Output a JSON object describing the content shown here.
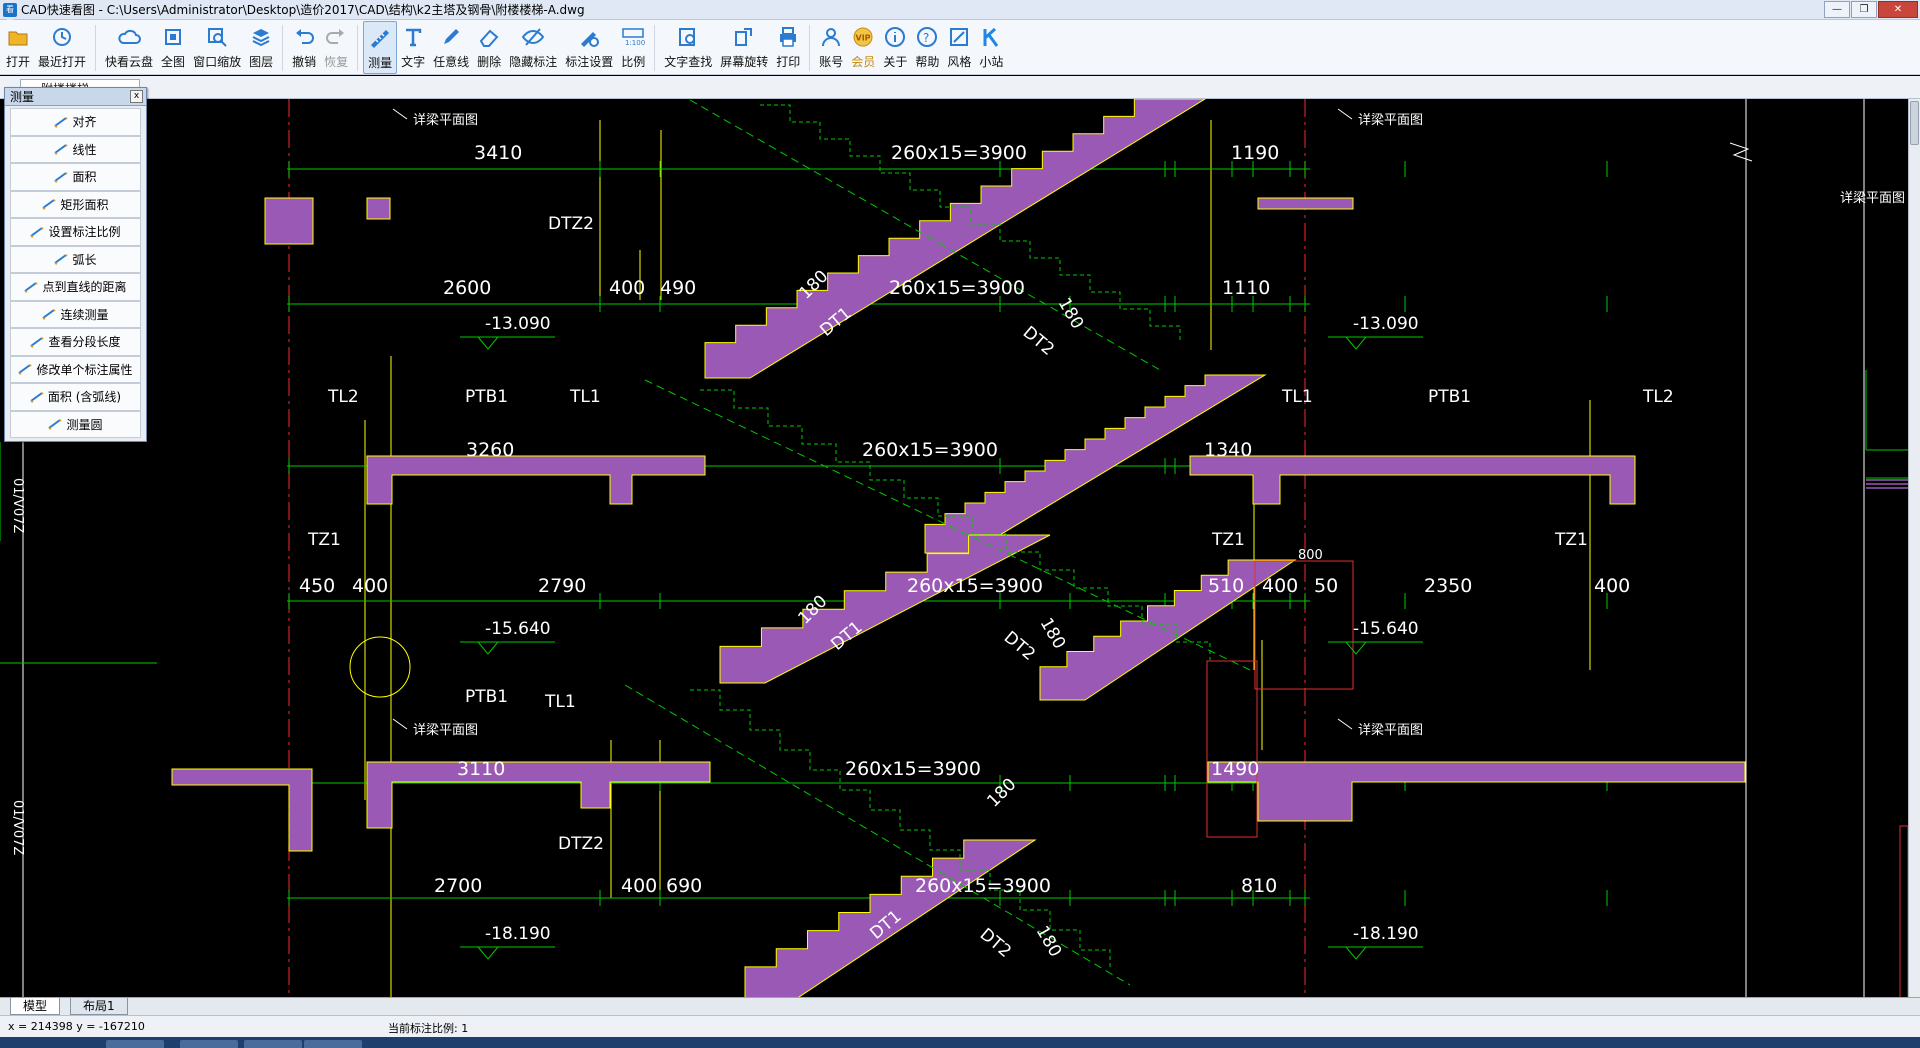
{
  "window": {
    "app_icon": "看图",
    "title": "CAD快速看图 - C:\\Users\\Administrator\\Desktop\\造价2017\\CAD\\结构\\k2主塔及钢骨\\附楼楼梯-A.dwg",
    "min": "—",
    "max": "❐",
    "close": "✕"
  },
  "toolbar": {
    "buttons": [
      {
        "label": "打开",
        "icon": "open-folder-icon"
      },
      {
        "label": "最近打开",
        "icon": "recent-icon"
      },
      {
        "label": "快看云盘",
        "icon": "cloud-icon"
      },
      {
        "label": "全图",
        "icon": "fit-all-icon"
      },
      {
        "label": "窗口缩放",
        "icon": "window-zoom-icon"
      },
      {
        "label": "图层",
        "icon": "layers-icon"
      },
      {
        "label": "撤销",
        "icon": "undo-icon"
      },
      {
        "label": "恢复",
        "icon": "redo-icon"
      },
      {
        "label": "测量",
        "icon": "measure-icon"
      },
      {
        "label": "文字",
        "icon": "text-icon"
      },
      {
        "label": "任意线",
        "icon": "pen-icon"
      },
      {
        "label": "删除",
        "icon": "eraser-icon"
      },
      {
        "label": "隐藏标注",
        "icon": "hide-icon"
      },
      {
        "label": "标注设置",
        "icon": "annotation-settings-icon"
      },
      {
        "label": "比例",
        "icon": "scale-icon"
      },
      {
        "label": "文字查找",
        "icon": "text-search-icon"
      },
      {
        "label": "屏幕旋转",
        "icon": "rotate-icon"
      },
      {
        "label": "打印",
        "icon": "print-icon"
      },
      {
        "label": "账号",
        "icon": "account-icon"
      },
      {
        "label": "会员",
        "icon": "vip-icon"
      },
      {
        "label": "关于",
        "icon": "info-icon"
      },
      {
        "label": "帮助",
        "icon": "help-icon"
      },
      {
        "label": "风格",
        "icon": "style-icon"
      },
      {
        "label": "小站",
        "icon": "k-station-icon"
      }
    ],
    "vip_badge": "VIP",
    "active": "测量"
  },
  "doc_tab": {
    "label": "附楼楼梯"
  },
  "measure_panel": {
    "title": "测量",
    "close": "x",
    "items": [
      {
        "label": "对齐",
        "icon": "align-measure-icon"
      },
      {
        "label": "线性",
        "icon": "linear-measure-icon"
      },
      {
        "label": "面积",
        "icon": "area-icon"
      },
      {
        "label": "矩形面积",
        "icon": "rect-area-icon"
      },
      {
        "label": "设置标注比例",
        "icon": "set-scale-icon"
      },
      {
        "label": "弧长",
        "icon": "arc-length-icon"
      },
      {
        "label": "点到直线的距离",
        "icon": "point-line-distance-icon"
      },
      {
        "label": "连续测量",
        "icon": "continuous-measure-icon"
      },
      {
        "label": "查看分段长度",
        "icon": "segment-length-icon"
      },
      {
        "label": "修改单个标注属性",
        "icon": "edit-annotation-icon"
      },
      {
        "label": "面积 (含弧线)",
        "icon": "arc-area-icon"
      },
      {
        "label": "测量圆",
        "icon": "measure-circle-icon"
      }
    ]
  },
  "drawing": {
    "dims_row1": [
      "3410",
      "260x15=3900",
      "1190"
    ],
    "dims_row2": [
      "2600",
      "400",
      "490",
      "260x15=3900",
      "1110"
    ],
    "dims_row3": [
      "3260",
      "260x15=3900",
      "1340"
    ],
    "dims_row4": [
      "450",
      "400",
      "2790",
      "260x15=3900",
      "510",
      "400",
      "50",
      "2350",
      "400"
    ],
    "dims_row5": [
      "3110",
      "260x15=3900",
      "1490"
    ],
    "dims_row6": [
      "2700",
      "400",
      "690",
      "260x15=3900",
      "810"
    ],
    "labels": {
      "dtz2": "DTZ2",
      "tl2": "TL2",
      "tl1": "TL1",
      "ptb1": "PTB1",
      "tz1": "TZ1",
      "dt1": "DT1",
      "dt2": "DT2",
      "r180": "180",
      "detail": "详梁平面图",
      "small_note": "详梁平面图",
      "red_small": "800"
    },
    "elevations": [
      "-13.090",
      "-13.090",
      "-15.640",
      "-15.640",
      "-18.190",
      "-18.190"
    ],
    "side_marks": [
      "01/V07Z",
      "01/V07Z"
    ],
    "colors": {
      "purple": "#9b59b6",
      "yellow": "#ffff00",
      "green": "#00c800",
      "red": "#e03030",
      "white": "#ffffff",
      "grid_red": "#d02020"
    }
  },
  "layout_tabs": [
    "模型",
    "布局1"
  ],
  "status": {
    "coords": "x = 214398  y = -167210",
    "scale": "当前标注比例: 1"
  }
}
